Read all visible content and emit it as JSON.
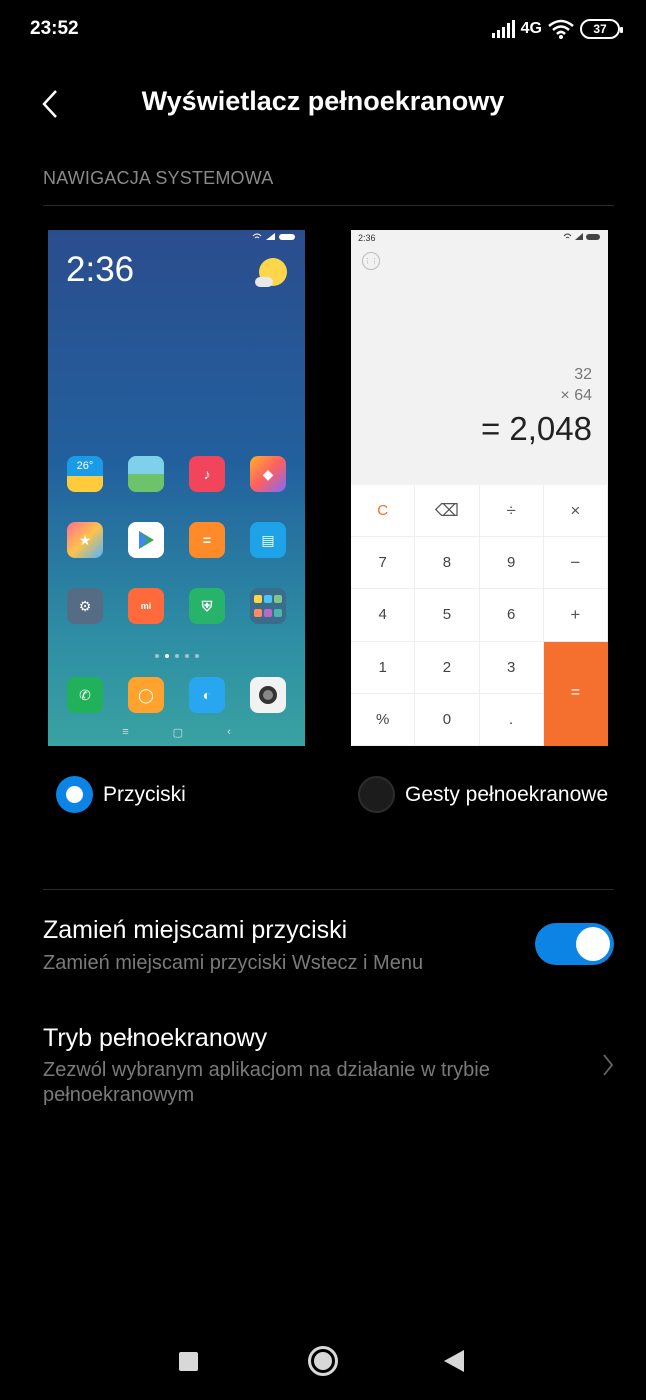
{
  "status_bar": {
    "time": "23:52",
    "network": "4G",
    "battery": "37"
  },
  "header": {
    "title": "Wyświetlacz pełnoekranowy",
    "back_icon": "chevron-left-icon"
  },
  "section": {
    "title": "NAWIGACJA SYSTEMOWA"
  },
  "preview_home": {
    "time": "2:36",
    "weather_temp": "26°"
  },
  "preview_calc": {
    "status_time": "2:36",
    "line1": "32",
    "line2": "×  64",
    "result": "= 2,048",
    "keys": [
      "C",
      "⌫",
      "÷",
      "×",
      "7",
      "8",
      "9",
      "−",
      "4",
      "5",
      "6",
      "+",
      "1",
      "2",
      "3",
      "%",
      "0",
      ".",
      "="
    ]
  },
  "radio_options": {
    "buttons_label": "Przyciski",
    "gestures_label": "Gesty pełnoekranowe",
    "selected": "buttons"
  },
  "settings": {
    "swap": {
      "title": "Zamień miejscami przyciski",
      "subtitle": "Zamień miejscami przyciski Wstecz i Menu",
      "enabled": true
    },
    "fullscreen": {
      "title": "Tryb pełnoekranowy",
      "subtitle": "Zezwól wybranym aplikacjom na działanie w trybie pełnoekranowym"
    }
  },
  "colors": {
    "accent": "#0b84e6",
    "calc_orange": "#f5702e"
  }
}
